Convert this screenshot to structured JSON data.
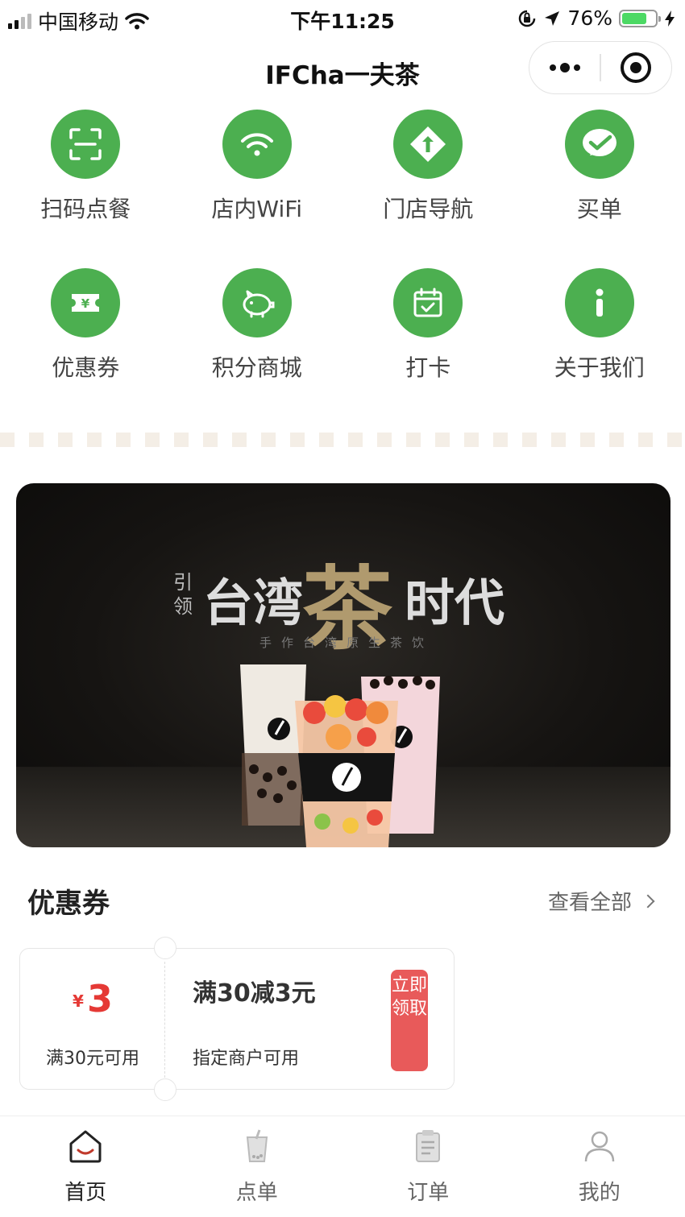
{
  "status_bar": {
    "carrier": "中国移动",
    "time": "下午11:25",
    "battery_percent": "76%",
    "battery_level": 0.76,
    "icons": [
      "signal-icon",
      "wifi-icon",
      "orientation-lock-icon",
      "location-icon",
      "battery-icon",
      "charging-icon"
    ]
  },
  "nav": {
    "title": "IFCha一夫茶",
    "capsule": [
      "more-icon",
      "close-miniprogram-icon"
    ]
  },
  "grid": [
    {
      "label": "扫码点餐",
      "icon": "scan-icon"
    },
    {
      "label": "店内WiFi",
      "icon": "wifi-icon"
    },
    {
      "label": "门店导航",
      "icon": "navigation-icon"
    },
    {
      "label": "买单",
      "icon": "pay-check-icon"
    },
    {
      "label": "优惠券",
      "icon": "coupon-icon"
    },
    {
      "label": "积分商城",
      "icon": "piggy-bank-icon"
    },
    {
      "label": "打卡",
      "icon": "checkin-calendar-icon"
    },
    {
      "label": "关于我们",
      "icon": "info-icon"
    }
  ],
  "colors": {
    "accent_green": "#4caf50",
    "coupon_red": "#e53935",
    "claim_bg": "#e85a5a"
  },
  "banner": {
    "small_text_1": "引",
    "small_text_2": "领",
    "headline_left": "台湾",
    "headline_tea": "茶",
    "headline_right": "时代",
    "subtitle": "手作台湾原生茶饮"
  },
  "coupons_section": {
    "title": "优惠券",
    "more_label": "查看全部",
    "coupons": [
      {
        "currency": "¥",
        "amount": "3",
        "condition": "满30元可用",
        "title": "满30减3元",
        "scope": "指定商户可用",
        "claim_label": "立即领取"
      }
    ]
  },
  "tabbar": [
    {
      "label": "首页",
      "icon": "home-icon",
      "active": true
    },
    {
      "label": "点单",
      "icon": "drink-cup-icon",
      "active": false
    },
    {
      "label": "订单",
      "icon": "order-clipboard-icon",
      "active": false
    },
    {
      "label": "我的",
      "icon": "user-icon",
      "active": false
    }
  ]
}
